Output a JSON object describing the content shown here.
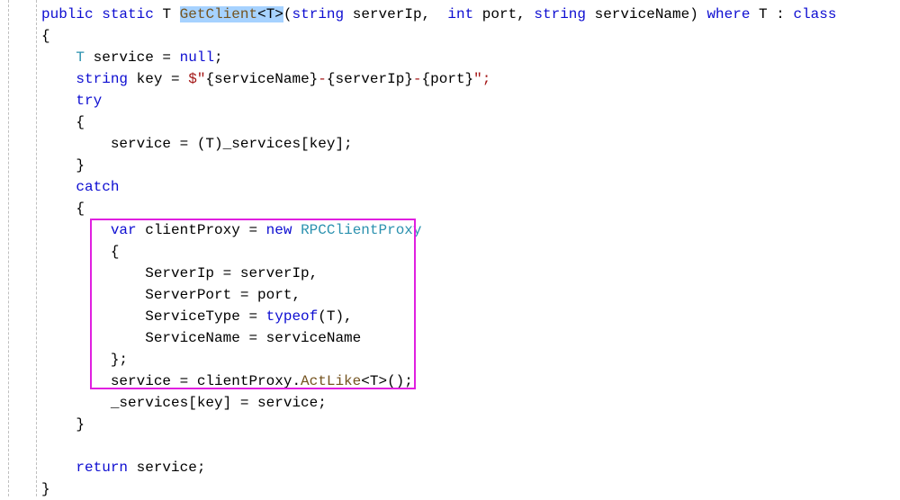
{
  "code": {
    "signature": {
      "public": "public",
      "static": "static",
      "T": "T",
      "method": "GetClient",
      "generic_open": "<",
      "generic_close": ">",
      "lparen": "(",
      "rparen": ")",
      "string1": "string",
      "param1": " serverIp, ",
      "int": "int",
      "param2": " port, ",
      "string2": "string",
      "param3": " serviceName",
      "where": "where",
      "space_T": " T : ",
      "class": "class"
    },
    "l1_brace_open": "{",
    "l2_decl_T": "T",
    "l2_rest": " service = ",
    "l2_null": "null",
    "l2_semi": ";",
    "l3_string": "string",
    "l3_key_eq": " key = ",
    "l3_dollar": "$\"",
    "l3_tpl_open1": "{",
    "l3_tpl_v1": "serviceName",
    "l3_tpl_close1": "}",
    "l3_dash1": "-",
    "l3_tpl_open2": "{",
    "l3_tpl_v2": "serverIp",
    "l3_tpl_close2": "}",
    "l3_dash2": "-",
    "l3_tpl_open3": "{",
    "l3_tpl_v3": "port",
    "l3_tpl_close3": "}",
    "l3_end": "\";",
    "l4_try": "try",
    "l5_brace": "{",
    "l6_service_eq": "service = (T)_services[key];",
    "l7_brace": "}",
    "l8_catch": "catch",
    "l9_brace": "{",
    "l10_var": "var",
    "l10_rest": " clientProxy = ",
    "l10_new": "new",
    "l10_space": " ",
    "l10_type": "RPCClientProxy",
    "l11_brace": "{",
    "l12": "ServerIp = serverIp,",
    "l13": "ServerPort = port,",
    "l14_a": "ServiceType = ",
    "l14_typeof": "typeof",
    "l14_b": "(T),",
    "l15": "ServiceName = serviceName",
    "l16_brace": "};",
    "l17_a": "service = clientProxy.",
    "l17_mth": "ActLike",
    "l17_b": "<T>();",
    "l18": "_services[key] = service;",
    "l19_brace": "}",
    "l21_return": "return",
    "l21_rest": " service;",
    "l22_brace": "}"
  }
}
